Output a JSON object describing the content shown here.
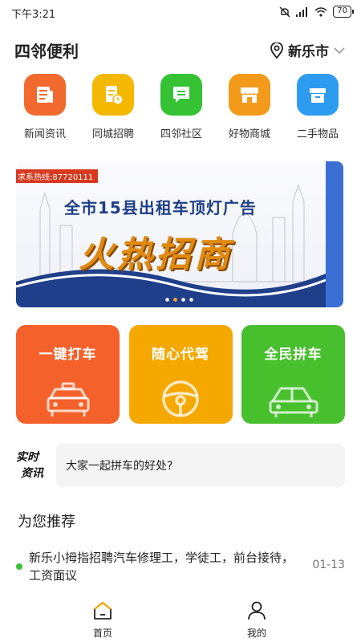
{
  "status_bar": {
    "time": "下午3:21",
    "battery": "70"
  },
  "header": {
    "title": "四邻便利",
    "city": "新乐市"
  },
  "categories": [
    {
      "label": "新闻资讯",
      "color": "#f26a2e",
      "icon": "news-icon"
    },
    {
      "label": "同城招聘",
      "color": "#f5b800",
      "icon": "recruit-icon"
    },
    {
      "label": "四邻社区",
      "color": "#35c235",
      "icon": "community-icon"
    },
    {
      "label": "好物商城",
      "color": "#f39a1a",
      "icon": "shop-icon"
    },
    {
      "label": "二手物品",
      "color": "#2d9cf0",
      "icon": "secondhand-icon"
    }
  ],
  "banner": {
    "hotline": "求系热线:87720111",
    "title": "全市15县出租车顶灯广告",
    "slogan": "火热招商",
    "active_index": 1,
    "count": 4
  },
  "rides": [
    {
      "label": "一键打车",
      "color": "#f5612a",
      "icon": "taxi-icon"
    },
    {
      "label": "随心代驾",
      "color": "#f5a800",
      "icon": "steering-wheel-icon"
    },
    {
      "label": "全民拼车",
      "color": "#48c02e",
      "icon": "car-icon"
    }
  ],
  "news": {
    "logo_line1": "实时",
    "logo_line2": "资讯",
    "headline": "大家一起拼车的好处?"
  },
  "recommend": {
    "title": "为您推荐",
    "items": [
      {
        "text": "新乐小拇指招聘汽车修理工，学徒工，前台接待，工资面议",
        "date": "01-13"
      }
    ]
  },
  "tabbar": {
    "home": "首页",
    "mine": "我的"
  }
}
